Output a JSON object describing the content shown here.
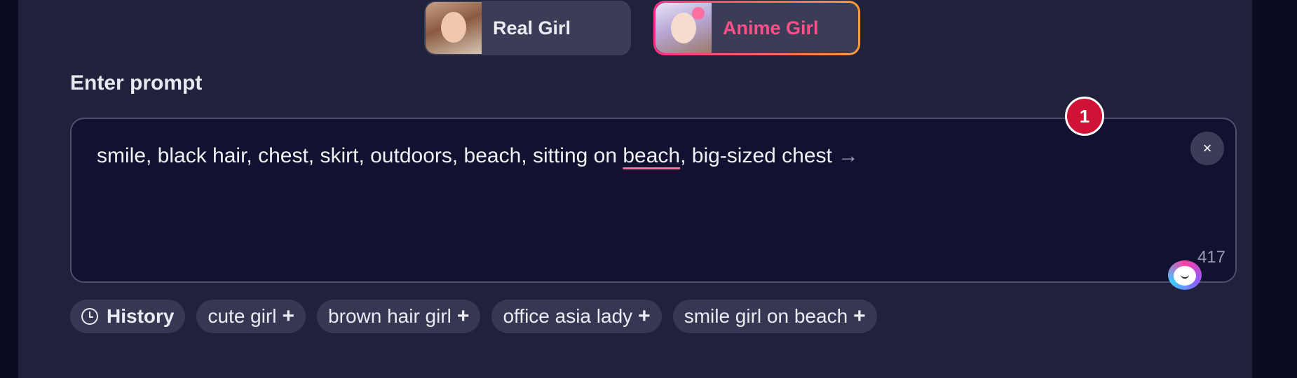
{
  "mode_toggle": {
    "real_label": "Real Girl",
    "anime_label": "Anime Girl",
    "selected": "Anime Girl"
  },
  "prompt": {
    "title": "Enter prompt",
    "text_before": "smile, black hair, chest, skirt, outdoors, beach, sitting on ",
    "text_underlined": "beach",
    "text_after": ", big-sized chest",
    "arrow": "→",
    "clear_icon": "×",
    "char_count": "417",
    "notification_count": "1"
  },
  "chips": {
    "history_label": "History",
    "items": [
      {
        "label": "cute girl",
        "plus": "+"
      },
      {
        "label": "brown hair girl",
        "plus": "+"
      },
      {
        "label": "office asia lady",
        "plus": "+"
      },
      {
        "label": "smile girl on beach",
        "plus": "+"
      }
    ]
  },
  "colors": {
    "panel_bg": "#20213a",
    "accent_gradient_start": "#ff2f8a",
    "accent_gradient_end": "#ff9a3c",
    "badge_red": "#d11237"
  }
}
